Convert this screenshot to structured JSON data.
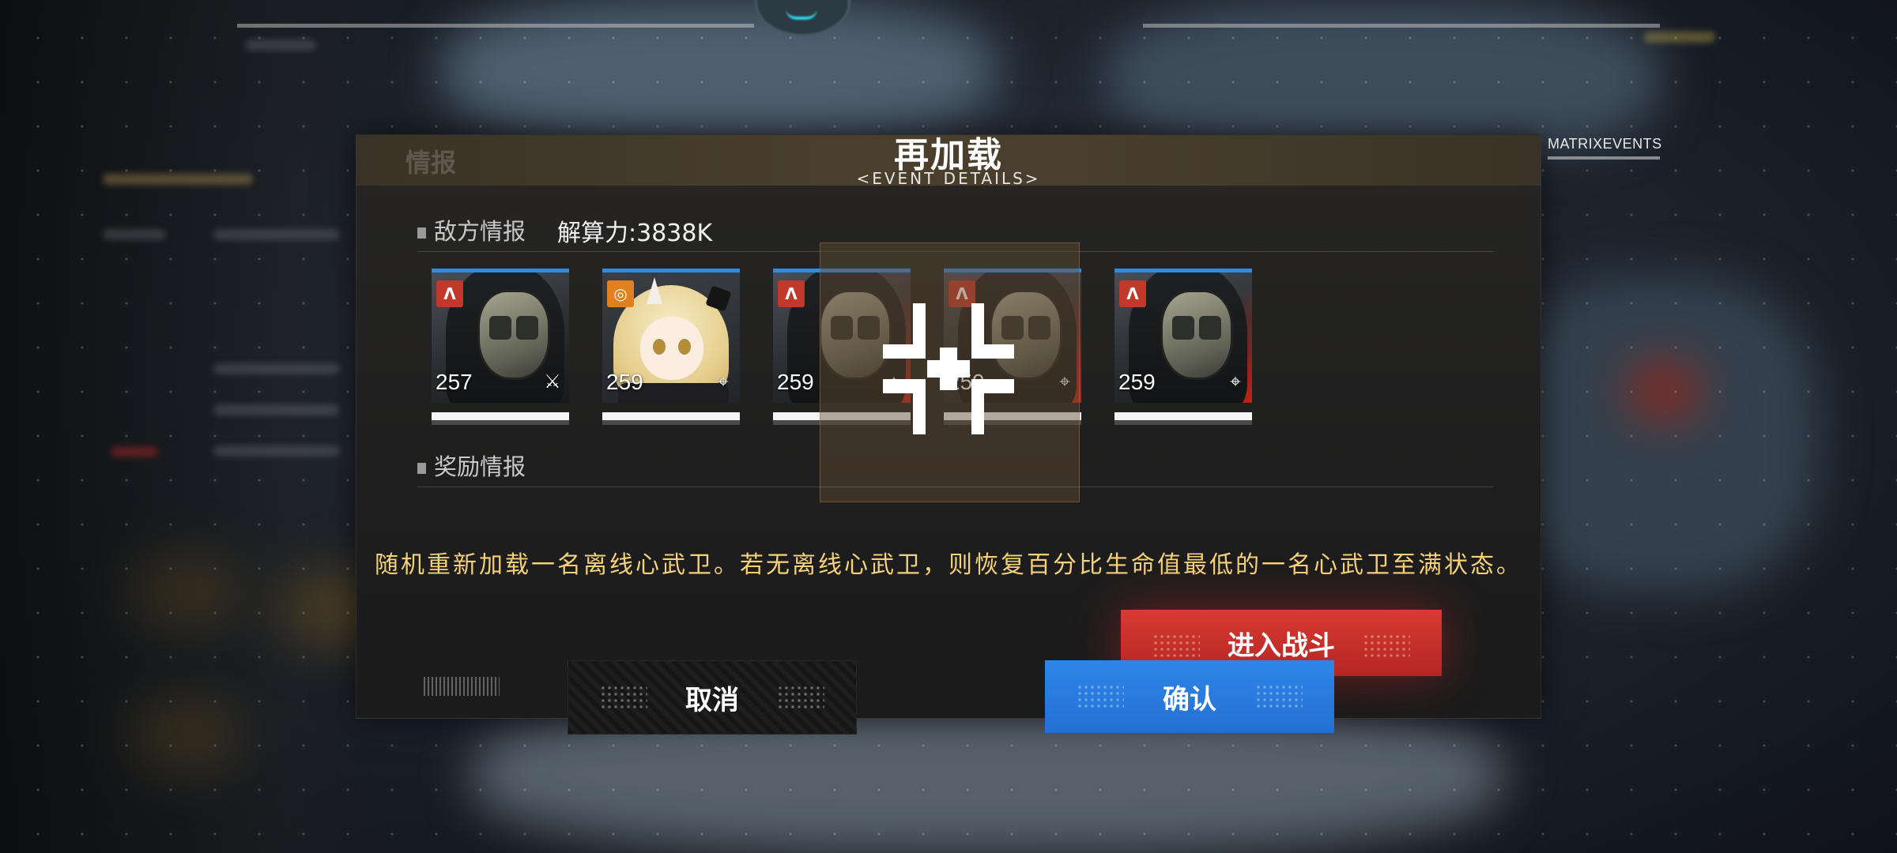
{
  "dialog": {
    "title": "再加载",
    "subtitle": "<EVENT DETAILS>",
    "brand": "MATRIXEVENTS",
    "header_faded": "情报"
  },
  "enemy_section": {
    "heading": "敌方情报",
    "power": "解算力:3838K",
    "enemies": [
      {
        "level": "257",
        "faction_icon": "a-faction-icon",
        "faction_color": "#c0392b",
        "role_icon": "crossed-swords-icon"
      },
      {
        "level": "259",
        "faction_icon": "swirl-faction-icon",
        "faction_color": "#e0801e",
        "role_icon": "crosshair-icon"
      },
      {
        "level": "259",
        "faction_icon": "a-faction-icon",
        "faction_color": "#c0392b",
        "role_icon": "crosshair-icon"
      },
      {
        "level": "259",
        "faction_icon": "a-faction-icon",
        "faction_color": "#c0392b",
        "role_icon": "crosshair-icon"
      },
      {
        "level": "259",
        "faction_icon": "a-faction-icon",
        "faction_color": "#c0392b",
        "role_icon": "crosshair-icon"
      }
    ]
  },
  "reward_section": {
    "heading": "奖励情报"
  },
  "description": "随机重新加载一名离线心武卫。若无离线心武卫，则恢复百分比生命值最低的一名心武卫至满状态。",
  "buttons": {
    "battle": "进入战斗",
    "cancel": "取消",
    "confirm": "确认"
  },
  "colors": {
    "accent_blue": "#2f86e8",
    "battle_red": "#d83a34",
    "description_gold": "#f5d27a"
  }
}
